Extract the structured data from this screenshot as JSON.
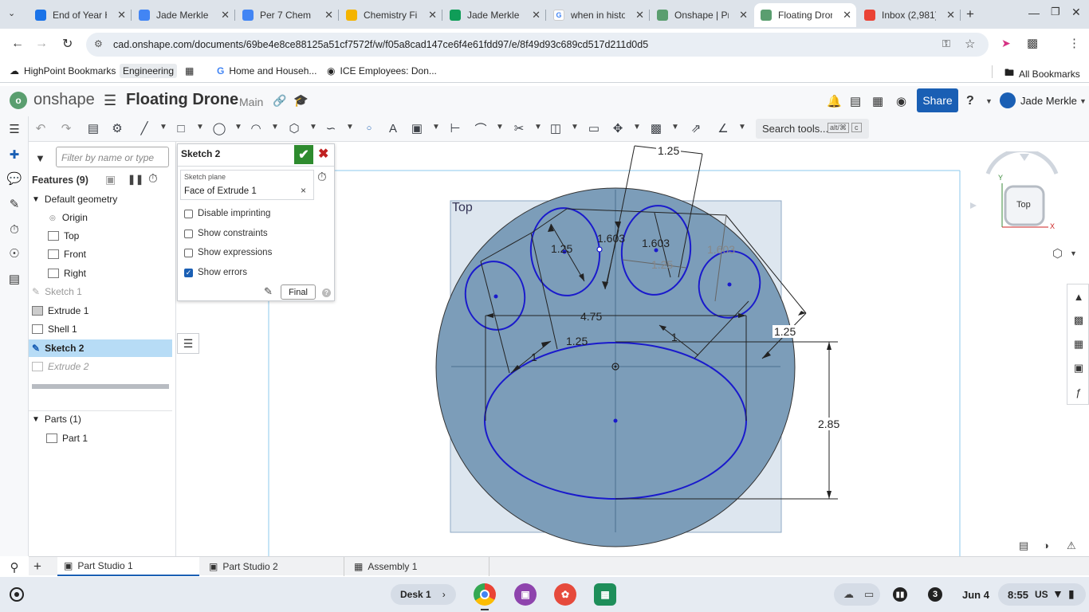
{
  "browser": {
    "tabs": [
      {
        "title": "End of Year H",
        "color": "#1a73e8",
        "icon": "docs-icon"
      },
      {
        "title": "Jade Merkle -",
        "color": "#4285f4",
        "icon": "docs-icon"
      },
      {
        "title": "Per 7 Chem F",
        "color": "#4285f4",
        "icon": "docs-icon"
      },
      {
        "title": "Chemistry Fin",
        "color": "#f4b400",
        "icon": "slides-icon"
      },
      {
        "title": "Jade Merkle |",
        "color": "#0f9d58",
        "icon": "classroom-icon"
      },
      {
        "title": "when in histo",
        "color": "#ffffff",
        "icon": "google-icon"
      },
      {
        "title": "Onshape | Pr",
        "color": "#5a9e6f",
        "icon": "onshape-icon"
      },
      {
        "title": "Floating Dron",
        "color": "#5a9e6f",
        "icon": "onshape-icon",
        "active": true
      },
      {
        "title": "Inbox (2,981)",
        "color": "#ea4335",
        "icon": "gmail-icon"
      }
    ],
    "url": "cad.onshape.com/documents/69be4e8ce88125a51cf7572f/w/f05a8cad147ce6f4e61fdd97/e/8f49d93c689cd517d211d0d5",
    "bookmarks": [
      "HighPoint Bookmarks",
      "Engineering",
      "Home and Househ...",
      "ICE Employees: Don...",
      "All Bookmarks"
    ]
  },
  "onshape": {
    "brand": "onshape",
    "doc_title": "Floating Drone",
    "branch": "Main",
    "share_label": "Share",
    "user_name": "Jade Merkle",
    "search_tools": "Search tools...",
    "search_shortcut_1": "alt/⌘",
    "search_shortcut_2": "c"
  },
  "features": {
    "filter_placeholder": "Filter by name or type",
    "header": "Features (9)",
    "items": [
      {
        "label": "Default geometry",
        "type": "group"
      },
      {
        "label": "Origin",
        "type": "origin"
      },
      {
        "label": "Top",
        "type": "plane"
      },
      {
        "label": "Front",
        "type": "plane"
      },
      {
        "label": "Right",
        "type": "plane"
      },
      {
        "label": "Sketch 1",
        "type": "sketch-dim"
      },
      {
        "label": "Extrude 1",
        "type": "feature"
      },
      {
        "label": "Shell 1",
        "type": "feature"
      },
      {
        "label": "Sketch 2",
        "type": "sketch-active"
      },
      {
        "label": "Extrude 2",
        "type": "rolled-back"
      }
    ],
    "parts_header": "Parts (1)",
    "parts": [
      "Part 1"
    ]
  },
  "sketch_dialog": {
    "title": "Sketch 2",
    "plane_label": "Sketch plane",
    "plane_value": "Face of Extrude 1",
    "options": [
      {
        "label": "Disable imprinting",
        "checked": false
      },
      {
        "label": "Show constraints",
        "checked": false
      },
      {
        "label": "Show expressions",
        "checked": false
      },
      {
        "label": "Show errors",
        "checked": true
      }
    ],
    "final_label": "Final"
  },
  "canvas": {
    "plane_name": "Top",
    "view_cube_label": "Top",
    "axis_y": "Y",
    "axis_x": "X",
    "dimensions": [
      "1.25",
      "1.603",
      "1.603",
      "1.25",
      "1.603",
      "1.25",
      "4.75",
      "1.25",
      "1",
      "1",
      "1.25",
      "2.85"
    ]
  },
  "bottom_tabs": [
    "Part Studio 1",
    "Part Studio 2",
    "Assembly 1"
  ],
  "shelf": {
    "desk": "Desk 1",
    "notif_count": "3",
    "date": "Jun 4",
    "time": "8:55",
    "locale": "US"
  }
}
